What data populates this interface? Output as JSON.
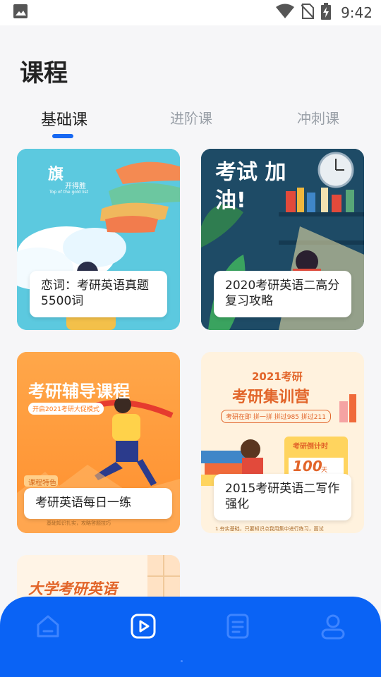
{
  "status_bar": {
    "time": "9:42",
    "icons": [
      "image-icon",
      "wifi-icon",
      "no-sim-icon",
      "battery-charging-icon"
    ]
  },
  "page": {
    "title": "课程"
  },
  "tabs": [
    {
      "label": "基础课",
      "active": true
    },
    {
      "label": "进阶课",
      "active": false
    },
    {
      "label": "冲刺课",
      "active": false
    }
  ],
  "courses": [
    {
      "title": "恋词：考研英语真题5500词",
      "art_text": "旗",
      "art_subtext": "开得胜",
      "art_caption": "Top of the gold list"
    },
    {
      "title": "2020考研英语二高分复习攻略",
      "art_text": "考试 加油!"
    },
    {
      "title": "考研英语每日一练",
      "art_text": "考研辅导课程",
      "art_subtext": "开启2021考研大促模式",
      "badge": "课程特色",
      "art_caption": "基础知识扎实，攻略答题技巧"
    },
    {
      "title": "2015考研英语二写作强化",
      "art_text": "2021考研",
      "art_subtext": "考研集训营",
      "art_tagline": "考研在即 拼一拼 拼过985 拼过211",
      "art_counter_label": "考研倒计时",
      "art_counter_value": "100",
      "art_counter_unit": "天",
      "art_caption": "1.夯实基础，只要知识点我用集中进行练习，面试"
    },
    {
      "title": "",
      "art_text": "大学考研英语"
    }
  ],
  "bottom_nav": [
    {
      "name": "home",
      "icon": "home-icon",
      "active": false
    },
    {
      "name": "course",
      "icon": "play-icon",
      "active": true
    },
    {
      "name": "list",
      "icon": "document-icon",
      "active": false
    },
    {
      "name": "user",
      "icon": "user-icon",
      "active": false
    }
  ],
  "colors": {
    "accent": "#1768f2",
    "nav_bg": "#0a63f5",
    "tab_inactive": "#9aa0a8"
  }
}
